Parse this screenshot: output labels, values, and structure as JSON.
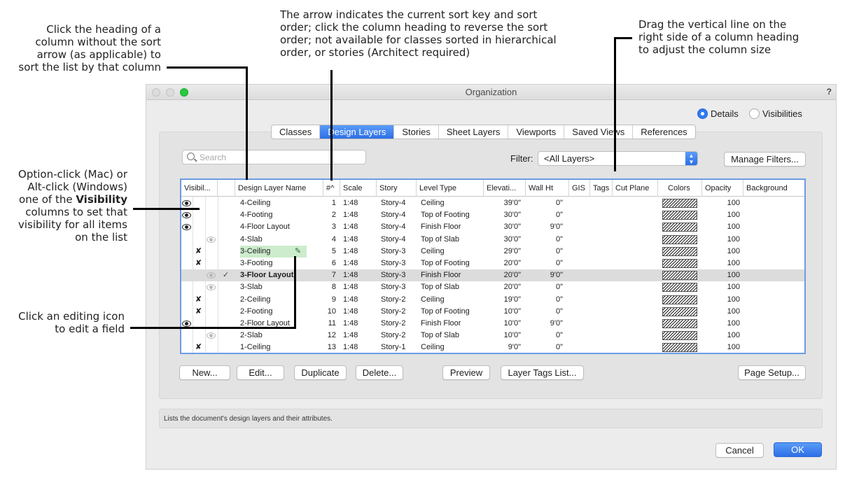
{
  "annotations": {
    "sort_heading_lines": [
      "Click the heading of a",
      "column without the sort",
      "arrow (as applicable) to",
      "sort the list by that column"
    ],
    "sort_arrow_lines": [
      "The arrow indicates the current sort key and sort",
      "order; click the column heading to reverse the sort",
      "order; not available for classes sorted in hierarchical",
      "order, or stories (Architect required)"
    ],
    "drag_line_lines": [
      "Drag the vertical line on the",
      "right side of a column heading",
      "to adjust the column size"
    ],
    "visibility": {
      "line1": "Option-click (Mac) or",
      "line2": "Alt-click (Windows)",
      "line3_prefix": "one of the ",
      "line3_bold": "Visibility",
      "line4": "columns to set that",
      "line5": "visibility for all items",
      "line6": "on the list"
    },
    "editing_lines": [
      "Click an editing icon",
      "to edit a field"
    ]
  },
  "window": {
    "title": "Organization",
    "help": "?",
    "colors": {
      "accent": "#2f7bf5",
      "close": "#dcdcdc",
      "min": "#dcdcdc",
      "zoom": "#27c93f"
    }
  },
  "view_mode": {
    "details": "Details",
    "visibilities": "Visibilities",
    "selected": "details"
  },
  "tabs": [
    "Classes",
    "Design Layers",
    "Stories",
    "Sheet Layers",
    "Viewports",
    "Saved Views",
    "References"
  ],
  "active_tab": "Design Layers",
  "search": {
    "placeholder": "Search"
  },
  "filter": {
    "label": "Filter:",
    "value": "<All Layers>"
  },
  "buttons": {
    "manage_filters": "Manage Filters...",
    "new": "New...",
    "edit": "Edit...",
    "duplicate": "Duplicate",
    "delete": "Delete...",
    "preview": "Preview",
    "layer_tags": "Layer Tags List...",
    "page_setup": "Page Setup...",
    "cancel": "Cancel",
    "ok": "OK"
  },
  "columns": {
    "visibility": "Visibil...",
    "name": "Design Layer Name",
    "num": "#^",
    "scale": "Scale",
    "story": "Story",
    "level": "Level Type",
    "elev": "Elevati...",
    "wall": "Wall Ht",
    "gis": "GIS",
    "tags": "Tags",
    "cut": "Cut Plane",
    "colors": "Colors",
    "opacity": "Opacity",
    "background": "Background"
  },
  "rows": [
    {
      "vis": "eye",
      "name": "4-Ceiling",
      "num": "1",
      "scale": "1:48",
      "story": "Story-4",
      "level": "Ceiling",
      "elev": "39'0\"",
      "wall": "0\"",
      "opacity": "100"
    },
    {
      "vis": "eye",
      "name": "4-Footing",
      "num": "2",
      "scale": "1:48",
      "story": "Story-4",
      "level": "Top of Footing",
      "elev": "30'0\"",
      "wall": "0\"",
      "opacity": "100"
    },
    {
      "vis": "eye",
      "name": "4-Floor Layout",
      "num": "3",
      "scale": "1:48",
      "story": "Story-4",
      "level": "Finish Floor",
      "elev": "30'0\"",
      "wall": "9'0\"",
      "opacity": "100"
    },
    {
      "vis": "grey",
      "name": "4-Slab",
      "num": "4",
      "scale": "1:48",
      "story": "Story-4",
      "level": "Top of Slab",
      "elev": "30'0\"",
      "wall": "0\"",
      "opacity": "100"
    },
    {
      "vis": "x",
      "name": "3-Ceiling",
      "num": "5",
      "scale": "1:48",
      "story": "Story-3",
      "level": "Ceiling",
      "elev": "29'0\"",
      "wall": "0\"",
      "opacity": "100",
      "editing": true
    },
    {
      "vis": "x",
      "name": "3-Footing",
      "num": "6",
      "scale": "1:48",
      "story": "Story-3",
      "level": "Top of Footing",
      "elev": "20'0\"",
      "wall": "0\"",
      "opacity": "100"
    },
    {
      "vis": "grey",
      "name": "3-Floor Layout",
      "num": "7",
      "scale": "1:48",
      "story": "Story-3",
      "level": "Finish Floor",
      "elev": "20'0\"",
      "wall": "9'0\"",
      "opacity": "100",
      "active": true
    },
    {
      "vis": "grey",
      "name": "3-Slab",
      "num": "8",
      "scale": "1:48",
      "story": "Story-3",
      "level": "Top of Slab",
      "elev": "20'0\"",
      "wall": "0\"",
      "opacity": "100"
    },
    {
      "vis": "x",
      "name": "2-Ceiling",
      "num": "9",
      "scale": "1:48",
      "story": "Story-2",
      "level": "Ceiling",
      "elev": "19'0\"",
      "wall": "0\"",
      "opacity": "100"
    },
    {
      "vis": "x",
      "name": "2-Footing",
      "num": "10",
      "scale": "1:48",
      "story": "Story-2",
      "level": "Top of Footing",
      "elev": "10'0\"",
      "wall": "0\"",
      "opacity": "100"
    },
    {
      "vis": "eye",
      "name": "2-Floor Layout",
      "num": "11",
      "scale": "1:48",
      "story": "Story-2",
      "level": "Finish Floor",
      "elev": "10'0\"",
      "wall": "9'0\"",
      "opacity": "100"
    },
    {
      "vis": "grey",
      "name": "2-Slab",
      "num": "12",
      "scale": "1:48",
      "story": "Story-2",
      "level": "Top of Slab",
      "elev": "10'0\"",
      "wall": "0\"",
      "opacity": "100"
    },
    {
      "vis": "x",
      "name": "1-Ceiling",
      "num": "13",
      "scale": "1:48",
      "story": "Story-1",
      "level": "Ceiling",
      "elev": "9'0\"",
      "wall": "0\"",
      "opacity": "100"
    }
  ],
  "status_text": "Lists the document's design layers and their attributes."
}
